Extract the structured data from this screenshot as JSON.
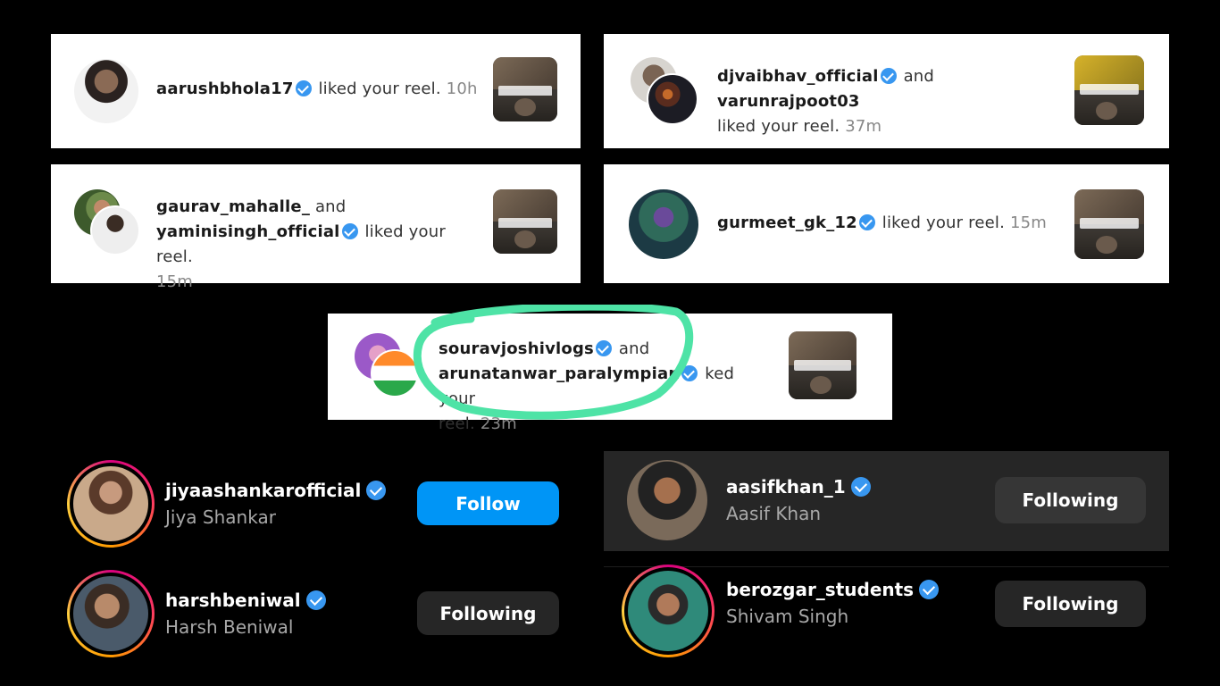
{
  "notifications": [
    {
      "user": "aarushbhola17",
      "text": "liked your reel.",
      "time": "10h"
    },
    {
      "user1": "djvaibhav_official",
      "connector": "and",
      "user2": "varunrajpoot03",
      "text": "liked your reel.",
      "time": "37m"
    },
    {
      "user1": "gaurav_mahalle_",
      "connector": "and",
      "user2": "yaminisingh_official",
      "text": "liked your reel.",
      "time": "15m"
    },
    {
      "user": "gurmeet_gk_12",
      "text": "liked your reel.",
      "time": "15m"
    },
    {
      "user1": "souravjoshivlogs",
      "connector": "and",
      "user2": "arunatanwar_paralympian",
      "text_part1": "ked your",
      "text_part2": "reel.",
      "time": "23m"
    }
  ],
  "accounts": [
    {
      "username": "jiyaashankarofficial",
      "name": "Jiya Shankar",
      "button": "Follow"
    },
    {
      "username": "aasifkhan_1",
      "name": "Aasif Khan",
      "button": "Following"
    },
    {
      "username": "harshbeniwal",
      "name": "Harsh Beniwal",
      "button": "Following"
    },
    {
      "username": "berozgar_students",
      "name": "Shivam Singh",
      "button": "Following"
    }
  ],
  "colors": {
    "follow_blue": "#0095f6",
    "verified_blue": "#3897f0",
    "highlight_green": "#4ee3a6",
    "following_bg": "#262626"
  }
}
